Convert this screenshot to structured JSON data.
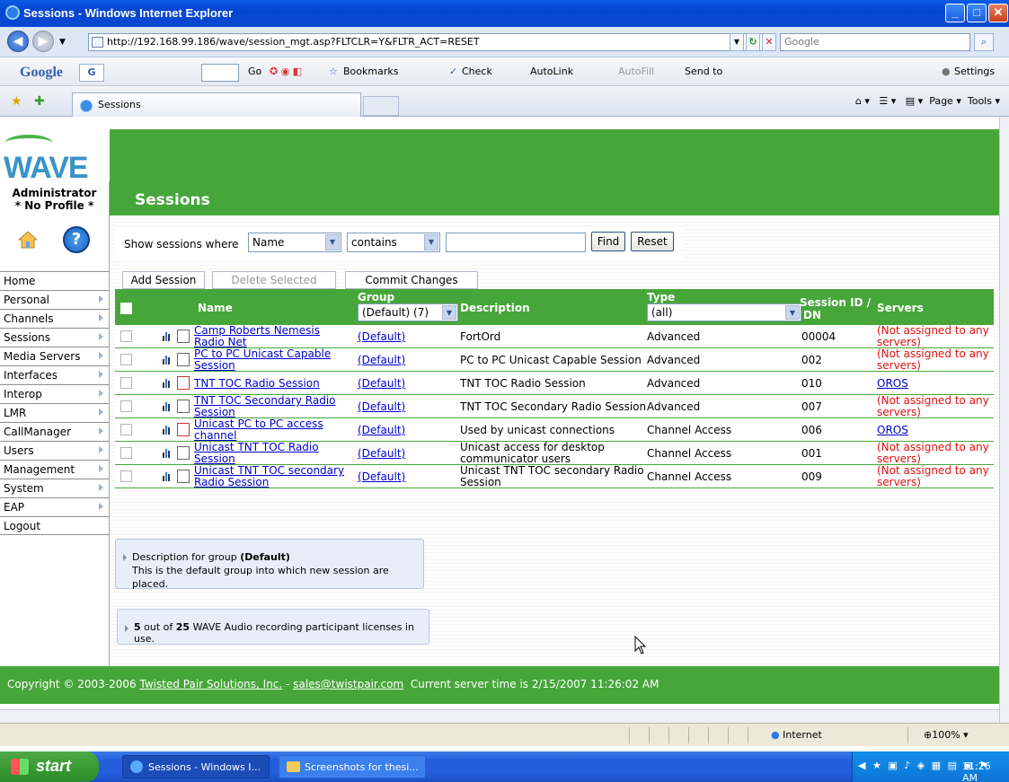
{
  "window": {
    "title": "Sessions - Windows Internet Explorer"
  },
  "browser": {
    "url": "http://192.168.99.186/wave/session_mgt.asp?FLTCLR=Y&FLTR_ACT=RESET",
    "search_placeholder": "Google",
    "tab_title": "Sessions",
    "tools": {
      "page_label": "Page",
      "tools_label": "Tools"
    }
  },
  "google_toolbar": {
    "logo": "Google",
    "go_label": "Go",
    "bookmarks_label": "Bookmarks",
    "check_label": "Check",
    "autolink_label": "AutoLink",
    "autofill_label": "AutoFill",
    "sendto_label": "Send to",
    "settings_label": "Settings"
  },
  "app": {
    "logo_text": "WAVE",
    "user_name": "Administrator",
    "profile": "* No Profile *",
    "page_title": "Sessions"
  },
  "nav": [
    {
      "label": "Home",
      "arrow": false
    },
    {
      "label": "Personal",
      "arrow": true
    },
    {
      "label": "Channels",
      "arrow": true
    },
    {
      "label": "Sessions",
      "arrow": true
    },
    {
      "label": "Media Servers",
      "arrow": true
    },
    {
      "label": "Interfaces",
      "arrow": true
    },
    {
      "label": "Interop",
      "arrow": true
    },
    {
      "label": "LMR",
      "arrow": true
    },
    {
      "label": "CallManager",
      "arrow": true
    },
    {
      "label": "Users",
      "arrow": true
    },
    {
      "label": "Management",
      "arrow": true
    },
    {
      "label": "System",
      "arrow": true
    },
    {
      "label": "EAP",
      "arrow": true
    },
    {
      "label": "Logout",
      "arrow": false
    }
  ],
  "filter": {
    "label": "Show sessions where",
    "field_value": "Name",
    "operator_value": "contains",
    "text_value": "",
    "find_label": "Find",
    "reset_label": "Reset"
  },
  "actions": {
    "add_label": "Add Session",
    "delete_label": "Delete Selected",
    "commit_label": "Commit Changes"
  },
  "table": {
    "headers": {
      "name": "Name",
      "group": "Group",
      "group_filter": "(Default) (7)",
      "description": "Description",
      "type": "Type",
      "type_filter": "(all)",
      "session_id_1": "Session ID /",
      "session_id_2": "DN",
      "servers": "Servers"
    },
    "rows": [
      {
        "name": "Camp Roberts Nemesis Radio Net",
        "group": "(Default)",
        "description": "FortOrd",
        "type": "Advanced",
        "id": "00004",
        "servers": "(Not assigned to any servers)",
        "assigned": false
      },
      {
        "name": "PC to PC Unicast Capable Session",
        "group": "(Default)",
        "description": "PC to PC Unicast Capable Session",
        "type": "Advanced",
        "id": "002",
        "servers": "(Not assigned to any servers)",
        "assigned": false
      },
      {
        "name": "TNT TOC Radio Session",
        "group": "(Default)",
        "description": "TNT TOC Radio Session",
        "type": "Advanced",
        "id": "010",
        "servers": "OROS",
        "assigned": true
      },
      {
        "name": "TNT TOC Secondary Radio Session",
        "group": "(Default)",
        "description": "TNT TOC Secondary Radio Session",
        "type": "Advanced",
        "id": "007",
        "servers": "(Not assigned to any servers)",
        "assigned": false
      },
      {
        "name": "Unicast PC to PC access channel",
        "group": "(Default)",
        "description": "Used by unicast connections",
        "type": "Channel Access",
        "id": "006",
        "servers": "OROS",
        "assigned": true
      },
      {
        "name": "Unicast TNT TOC Radio Session",
        "group": "(Default)",
        "description": "Unicast access for desktop communicator users",
        "type": "Channel Access",
        "id": "001",
        "servers": "(Not assigned to any servers)",
        "assigned": false
      },
      {
        "name": "Unicast TNT TOC secondary Radio Session",
        "group": "(Default)",
        "description": "Unicast TNT TOC secondary Radio Session",
        "type": "Channel Access",
        "id": "009",
        "servers": "(Not assigned to any servers)",
        "assigned": false
      }
    ]
  },
  "group_desc": {
    "prefix": "Description for group",
    "group": "(Default)",
    "text": "This is the default group into which new session are placed."
  },
  "license": {
    "used": "5",
    "mid": "out of",
    "total": "25",
    "suffix": "WAVE Audio recording participant licenses in use."
  },
  "footer": {
    "copyright": "Copyright © 2003-2006",
    "company": "Twisted Pair Solutions, Inc.",
    "sep": "-",
    "email": "sales@twistpair.com",
    "server_time": "Current server time is 2/15/2007 11:26:02 AM"
  },
  "statusbar": {
    "zone": "Internet",
    "zoom": "100%"
  },
  "taskbar": {
    "start_label": "start",
    "tasks": [
      "Sessions - Windows I...",
      "Screenshots for thesi..."
    ],
    "clock": "11:26 AM"
  },
  "colors": {
    "wave_green": "#47a63a",
    "link": "#0000cc",
    "unassigned_red": "#e01010"
  }
}
